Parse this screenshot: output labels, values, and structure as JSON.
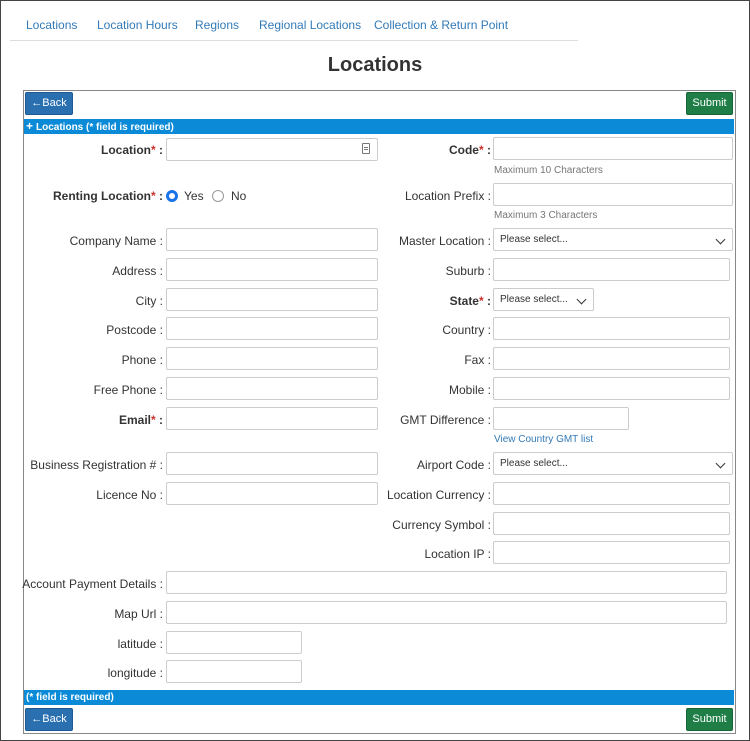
{
  "tabs": [
    "Locations",
    "Location Hours",
    "Regions",
    "Regional Locations",
    "Collection & Return Point"
  ],
  "page_title": "Locations",
  "buttons": {
    "back": "Back",
    "submit": "Submit",
    "back_icon": "arrow-left-icon"
  },
  "header_bar": {
    "icon": "plus-icon",
    "text": "Locations (* field is required)"
  },
  "footer_bar": {
    "text": "(* field is required)"
  },
  "form": {
    "location": "Location",
    "renting_location": "Renting Location",
    "renting_yes": "Yes",
    "renting_no": "No",
    "company_name": "Company Name :",
    "address": "Address :",
    "city": "City :",
    "postcode": "Postcode :",
    "phone": "Phone :",
    "free_phone": "Free Phone :",
    "email": "Email",
    "business_registration": "Business Registration # :",
    "licence_no": "Licence No :",
    "account_payment_details": "Account Payment Details :",
    "map_url": "Map Url :",
    "latitude": "latitude :",
    "longitude": "longitude :",
    "code": "Code",
    "code_hint": "Maximum 10 Characters",
    "location_prefix": "Location Prefix :",
    "prefix_hint": "Maximum 3 Characters",
    "master_location": "Master Location :",
    "suburb": "Suburb :",
    "state": "State",
    "country": "Country :",
    "fax": "Fax :",
    "mobile": "Mobile :",
    "gmt_difference": "GMT Difference :",
    "gmt_link": "View Country GMT list",
    "airport_code": "Airport Code :",
    "location_currency": "Location Currency :",
    "currency_symbol": "Currency Symbol :",
    "location_ip": "Location IP :",
    "select_placeholder": "Please select...",
    "required_mark": "*",
    "colon": " :"
  },
  "colors": {
    "primary": "#2a6fb0",
    "success": "#1e7e46",
    "bar": "#0a8ad7",
    "required": "#c9302c"
  }
}
